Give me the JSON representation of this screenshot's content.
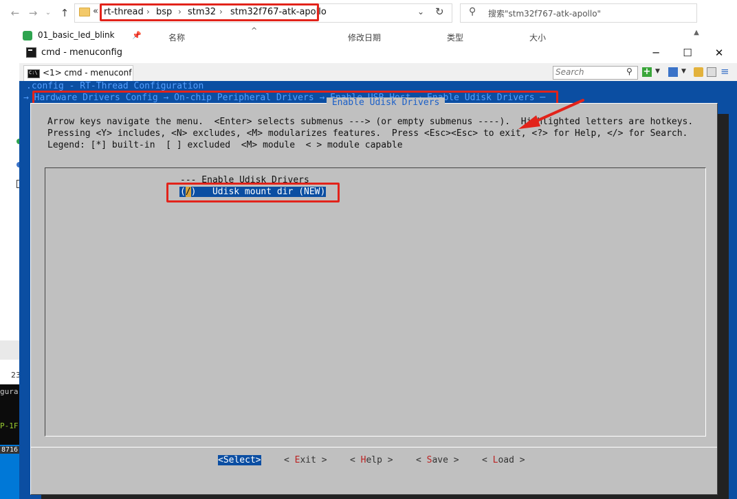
{
  "explorer": {
    "address": {
      "prefix": "«",
      "crumbs": [
        "rt-thread",
        "bsp",
        "stm32",
        "stm32f767-atk-apollo"
      ],
      "separator": "›"
    },
    "search_placeholder": "搜索\"stm32f767-atk-apollo\"",
    "quick_access_item": "01_basic_led_blink",
    "columns": [
      "名称",
      "修改日期",
      "类型",
      "大小"
    ],
    "status_count": "23"
  },
  "terminal_strip": {
    "line1": "gura",
    "line2": "P-1F",
    "line3": "8716"
  },
  "cmd_window": {
    "title": "cmd - menuconfig",
    "tab_label": "<1> cmd - menuconf",
    "search_placeholder": "Search",
    "controls": {
      "minimize": "─",
      "maximize": "☐",
      "close": "✕"
    }
  },
  "menuconfig": {
    "config_title": ".config - RT-Thread Configuration",
    "breadcrumb_prefix": "→ ",
    "breadcrumb": "Hardware Drivers Config → On-chip Peripheral Drivers → Enable USB Host → Enable Udisk Drivers ─",
    "dialog_title": " Enable Udisk Drivers ",
    "help_lines": [
      "Arrow keys navigate the menu.  <Enter> selects submenus ---> (or empty submenus ----).  Highlighted letters are hotkeys.",
      "Pressing <Y> includes, <N> excludes, <M> modularizes features.  Press <Esc><Esc> to exit, <?> for Help, </> for Search.",
      "Legend: [*] built-in  [ ] excluded  <M> module  < > module capable"
    ],
    "items": [
      {
        "text": "--- Enable Udisk Drivers"
      },
      {
        "cursor_open": "(",
        "cursor_char": "/",
        "rest": ")   Udisk mount dir (NEW)"
      }
    ],
    "buttons": [
      {
        "pre": "<",
        "hot": "S",
        "rest": "elect>"
      },
      {
        "pre": "< ",
        "hot": "E",
        "rest": "xit >"
      },
      {
        "pre": "< ",
        "hot": "H",
        "rest": "elp >"
      },
      {
        "pre": "< ",
        "hot": "S",
        "rest": "ave >"
      },
      {
        "pre": "< ",
        "hot": "L",
        "rest": "oad >"
      }
    ]
  },
  "colors": {
    "console_bg": "#0b4ea2",
    "dialog_bg": "#c0c0c0",
    "annotation_red": "#e2231a",
    "title_cyan": "#55a0ff"
  }
}
